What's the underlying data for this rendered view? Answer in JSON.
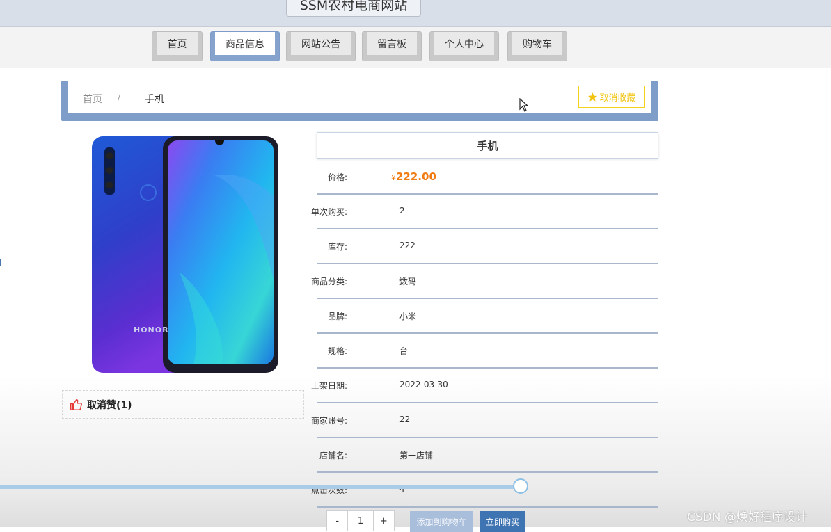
{
  "header": {
    "site_title": "SSM农村电商网站"
  },
  "nav": {
    "items": [
      {
        "label": "首页"
      },
      {
        "label": "商品信息"
      },
      {
        "label": "网站公告"
      },
      {
        "label": "留言板"
      },
      {
        "label": "个人中心"
      },
      {
        "label": "购物车"
      }
    ],
    "active_index": 1
  },
  "breadcrumb": {
    "home": "首页",
    "separator": "/",
    "current": "手机"
  },
  "favorite_button": {
    "label": "取消收藏",
    "icon": "star-icon",
    "color": "#f2c40f"
  },
  "product_image": {
    "brand_text": "HONOR"
  },
  "like": {
    "label": "取消赞(1)",
    "icon": "thumbs-up-icon"
  },
  "product": {
    "title": "手机",
    "price_label": "价格:",
    "currency": "¥",
    "price": "222.00",
    "details": [
      {
        "label": "单次购买:",
        "value": "2"
      },
      {
        "label": "库存:",
        "value": "222"
      },
      {
        "label": "商品分类:",
        "value": "数码"
      },
      {
        "label": "品牌:",
        "value": "小米"
      },
      {
        "label": "规格:",
        "value": "台"
      },
      {
        "label": "上架日期:",
        "value": "2022-03-30"
      },
      {
        "label": "商家账号:",
        "value": "22"
      },
      {
        "label": "店铺名:",
        "value": "第一店铺"
      },
      {
        "label": "点击次数:",
        "value": "4"
      }
    ]
  },
  "quantity": {
    "minus": "-",
    "value": "1",
    "plus": "+"
  },
  "actions": {
    "add_to_cart": "添加到购物车",
    "buy_now": "立即购买"
  },
  "watermark": "CSDN @焕好程序设计",
  "colors": {
    "accent": "#7e9dc9",
    "price": "#f07c14",
    "buy": "#3f74b3"
  }
}
